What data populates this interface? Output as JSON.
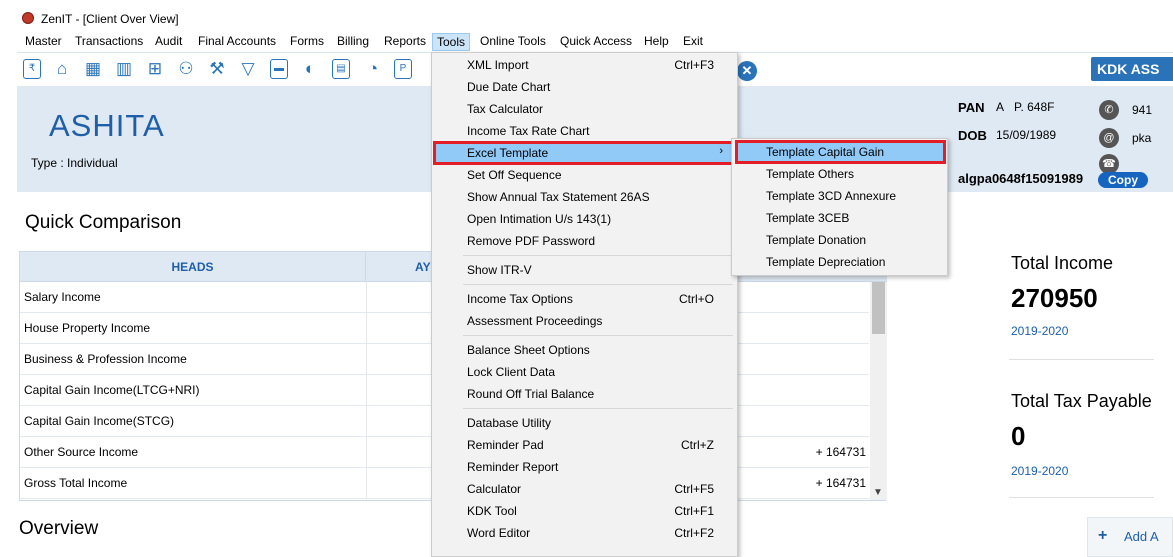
{
  "window": {
    "title": "ZenIT - [Client Over View]"
  },
  "menubar": [
    "Master",
    "Transactions",
    "Audit",
    "Final Accounts",
    "Forms",
    "Billing",
    "Reports",
    "Tools",
    "Online Tools",
    "Quick Access",
    "Help",
    "Exit"
  ],
  "toolbar": {
    "brand_label": "KDK ASS"
  },
  "client": {
    "name": "ASHITA",
    "type": "Type : Individual",
    "pan_label": "PAN",
    "pan_value": "A   P. 648F",
    "dob_label": "DOB",
    "dob_value": "15/09/1989",
    "user_id": "algpa0648f15091989",
    "phone": "941",
    "email": "pka",
    "copy_label": "Copy"
  },
  "quick_comparison": {
    "title": "Quick Comparison",
    "headers": [
      "HEADS",
      "AY"
    ],
    "rows": [
      {
        "label": "Salary Income",
        "value": ""
      },
      {
        "label": "House Property Income",
        "value": ""
      },
      {
        "label": "Business & Profession Income",
        "value": ""
      },
      {
        "label": "Capital Gain Income(LTCG+NRI)",
        "value": ""
      },
      {
        "label": "Capital Gain Income(STCG)",
        "value": ""
      },
      {
        "label": "Other Source Income",
        "value": "+ 164731"
      },
      {
        "label": "Gross Total Income",
        "value": "+ 164731"
      }
    ]
  },
  "overview": {
    "title": "Overview"
  },
  "summary": {
    "total_income_label": "Total Income",
    "total_income_value": "270950",
    "total_income_year": "2019-2020",
    "total_tax_label": "Total Tax Payable",
    "total_tax_value": "0",
    "total_tax_year": "2019-2020",
    "add_label": "Add A"
  },
  "tools_menu": {
    "items": [
      {
        "label": "XML Import",
        "shortcut": "Ctrl+F3"
      },
      {
        "label": "Due Date Chart",
        "shortcut": ""
      },
      {
        "label": "Tax Calculator",
        "shortcut": ""
      },
      {
        "label": "Income Tax Rate Chart",
        "shortcut": ""
      },
      {
        "label": "Excel Template",
        "shortcut": "",
        "submenu": true
      },
      {
        "label": "Set Off Sequence",
        "shortcut": ""
      },
      {
        "label": "Show Annual Tax Statement 26AS",
        "shortcut": ""
      },
      {
        "label": "Open Intimation U/s 143(1)",
        "shortcut": ""
      },
      {
        "label": "Remove PDF Password",
        "shortcut": ""
      },
      {
        "label": "Show ITR-V",
        "shortcut": ""
      },
      {
        "label": "Income Tax Options",
        "shortcut": "Ctrl+O"
      },
      {
        "label": "Assessment Proceedings",
        "shortcut": ""
      },
      {
        "label": "Balance Sheet Options",
        "shortcut": ""
      },
      {
        "label": "Lock Client Data",
        "shortcut": ""
      },
      {
        "label": "Round Off Trial Balance",
        "shortcut": ""
      },
      {
        "label": "Database Utility",
        "shortcut": ""
      },
      {
        "label": "Reminder Pad",
        "shortcut": "Ctrl+Z"
      },
      {
        "label": "Reminder Report",
        "shortcut": ""
      },
      {
        "label": "Calculator",
        "shortcut": "Ctrl+F5"
      },
      {
        "label": "KDK Tool",
        "shortcut": "Ctrl+F1"
      },
      {
        "label": "Word Editor",
        "shortcut": "Ctrl+F2"
      }
    ]
  },
  "excel_submenu": {
    "items": [
      "Template Capital Gain",
      "Template Others",
      "Template 3CD Annexure",
      "Template 3CEB",
      "Template Donation",
      "Template Depreciation"
    ]
  },
  "colors": {
    "accent": "#1e5fa8",
    "highlight_border": "#e41e26",
    "menu_highlight": "#91c9f7"
  }
}
